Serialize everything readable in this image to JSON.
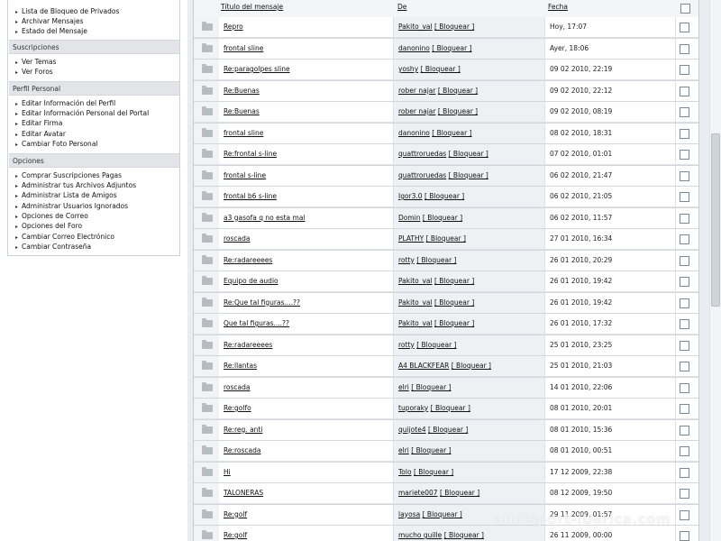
{
  "menu": {
    "top_items": [
      "Lista de Bloqueo de Privados",
      "Archivar Mensajes",
      "Estado del Mensaje"
    ],
    "sections": [
      {
        "title": "Suscripciones",
        "items": [
          "Ver Temas",
          "Ver Foros"
        ]
      },
      {
        "title": "Perfil Personal",
        "items": [
          "Editar Información del Perfil",
          "Editar Información Personal del Portal",
          "Editar Firma",
          "Editar Avatar",
          "Cambiar Foto Personal"
        ]
      },
      {
        "title": "Opciones",
        "items": [
          "Comprar Suscripciones Pagas",
          "Administrar tus Archivos Adjuntos",
          "Administrar Lista de Amigos",
          "Administrar Usuarios Ignorados",
          "Opciones de Correo",
          "Opciones del Foro",
          "Cambiar Correo Electrónico",
          "Cambiar Contraseña"
        ]
      }
    ]
  },
  "table": {
    "headers": {
      "subject": "Título del mensaje",
      "from": "De",
      "date": "Fecha"
    },
    "block_label": "[ Bloquear ]",
    "rows": [
      {
        "subject": "Repro",
        "from": "Pakito_val",
        "date": "Hoy, 17:07"
      },
      {
        "subject": "frontal sline",
        "from": "danonino",
        "date": "Ayer, 18:06"
      },
      {
        "subject": "Re:paragolpes sline",
        "from": "yoshy",
        "date": "09 02 2010, 22:19"
      },
      {
        "subject": "Re:Buenas",
        "from": "rober najar",
        "date": "09 02 2010, 22:12"
      },
      {
        "subject": "Re:Buenas",
        "from": "rober najar",
        "date": "09 02 2010, 08:19"
      },
      {
        "subject": "frontal sline",
        "from": "danonino",
        "date": "08 02 2010, 18:31"
      },
      {
        "subject": "Re:frontal s-line",
        "from": "quattroruedas",
        "date": "07 02 2010, 01:01"
      },
      {
        "subject": "frontal s-line",
        "from": "quattroruedas",
        "date": "06 02 2010, 21:47"
      },
      {
        "subject": "frontal b6 s-line",
        "from": "Igor3.0",
        "date": "06 02 2010, 21:05"
      },
      {
        "subject": "a3 gasofa q no esta mal",
        "from": "Domin",
        "date": "06 02 2010, 11:57"
      },
      {
        "subject": "roscada",
        "from": "PLATHY",
        "date": "27 01 2010, 16:34"
      },
      {
        "subject": "Re:radareeees",
        "from": "rotty",
        "date": "26 01 2010, 20:29"
      },
      {
        "subject": "Equipo de audio",
        "from": "Pakito_val",
        "date": "26 01 2010, 19:42"
      },
      {
        "subject": "Re:Que tal figuras....??",
        "from": "Pakito_val",
        "date": "26 01 2010, 19:42"
      },
      {
        "subject": "Que tal figuras....??",
        "from": "Pakito_val",
        "date": "26 01 2010, 17:32"
      },
      {
        "subject": "Re:radareeees",
        "from": "rotty",
        "date": "25 01 2010, 23:25"
      },
      {
        "subject": "Re:llantas",
        "from": "A4 BLACKFEAR",
        "date": "25 01 2010, 21:03"
      },
      {
        "subject": "roscada",
        "from": "elri",
        "date": "14 01 2010, 22:06"
      },
      {
        "subject": "Re:golfo",
        "from": "tuporaky",
        "date": "08 01 2010, 20:01"
      },
      {
        "subject": "Re:reg. anti",
        "from": "quijote4",
        "date": "08 01 2010, 15:36"
      },
      {
        "subject": "Re:roscada",
        "from": "elri",
        "date": "08 01 2010, 00:51"
      },
      {
        "subject": "Hi",
        "from": "Tolo",
        "date": "17 12 2009, 22:38"
      },
      {
        "subject": "TALONERAS",
        "from": "mariete007",
        "date": "08 12 2009, 19:50"
      },
      {
        "subject": "Re:golf",
        "from": "layosa",
        "date": "29 11 2009, 01:57"
      },
      {
        "subject": "Re:golf",
        "from": "mucho guille",
        "date": "26 11 2009, 00:00"
      }
    ]
  },
  "watermark": "audisport-iberica.com",
  "colors": {
    "header_bg": "#e2e4e7",
    "table_bg": "#dfe2e6",
    "alt_col": "#eef0f3"
  }
}
